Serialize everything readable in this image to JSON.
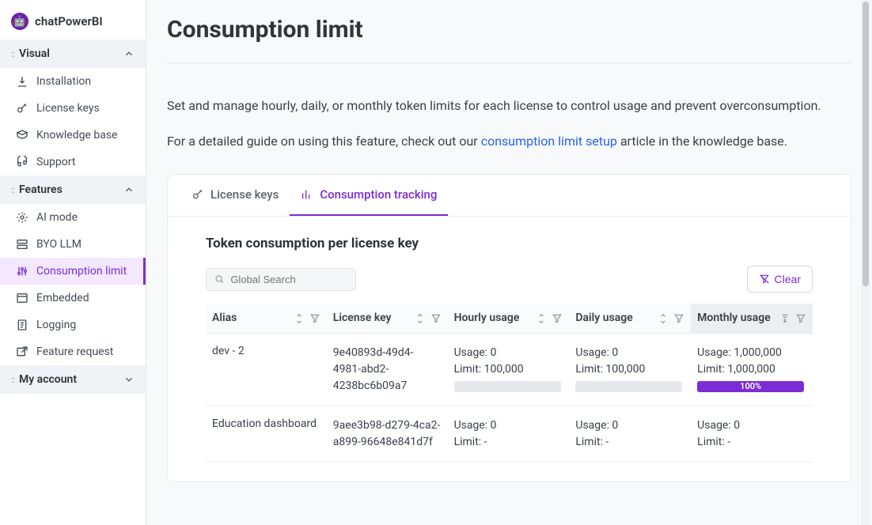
{
  "brand": "chatPowerBI",
  "sidebar": {
    "sections": [
      {
        "title": "Visual",
        "expanded": true,
        "items": [
          {
            "icon": "download",
            "label": "Installation"
          },
          {
            "icon": "key",
            "label": "License keys"
          },
          {
            "icon": "book",
            "label": "Knowledge base"
          },
          {
            "icon": "support",
            "label": "Support"
          }
        ]
      },
      {
        "title": "Features",
        "expanded": true,
        "items": [
          {
            "icon": "gear",
            "label": "AI mode"
          },
          {
            "icon": "server",
            "label": "BYO LLM"
          },
          {
            "icon": "sliders",
            "label": "Consumption limit",
            "active": true
          },
          {
            "icon": "embed",
            "label": "Embedded"
          },
          {
            "icon": "file",
            "label": "Logging"
          },
          {
            "icon": "open",
            "label": "Feature request"
          }
        ]
      },
      {
        "title": "My account",
        "expanded": false,
        "items": []
      }
    ]
  },
  "page": {
    "title": "Consumption limit",
    "desc1": "Set and manage hourly, daily, or monthly token limits for each license to control usage and prevent overconsumption.",
    "desc2_pre": "For a detailed guide on using this feature, check out our ",
    "desc2_link": "consumption limit setup",
    "desc2_post": " article in the knowledge base."
  },
  "tabs": [
    {
      "icon": "key",
      "label": "License keys"
    },
    {
      "icon": "chart",
      "label": "Consumption tracking",
      "active": true
    }
  ],
  "table": {
    "title": "Token consumption per license key",
    "search_placeholder": "Global Search",
    "clear_label": "Clear",
    "columns": [
      {
        "label": "Alias"
      },
      {
        "label": "License key"
      },
      {
        "label": "Hourly usage"
      },
      {
        "label": "Daily usage"
      },
      {
        "label": "Monthly usage",
        "sorted": true
      }
    ],
    "rows": [
      {
        "alias": "dev - 2",
        "key": "9e40893d-49d4-4981-abd2-4238bc6b09a7",
        "hourly": {
          "usage": "Usage: 0",
          "limit": "Limit: 100,000",
          "bar": "empty"
        },
        "daily": {
          "usage": "Usage: 0",
          "limit": "Limit: 100,000",
          "bar": "empty"
        },
        "monthly": {
          "usage": "Usage: 1,000,000",
          "limit": "Limit: 1,000,000",
          "bar": "100%"
        }
      },
      {
        "alias": "Education dashboard",
        "key": "9aee3b98-d279-4ca2-a899-96648e841d7f",
        "hourly": {
          "usage": "Usage: 0",
          "limit": "Limit: -"
        },
        "daily": {
          "usage": "Usage: 0",
          "limit": "Limit: -"
        },
        "monthly": {
          "usage": "Usage: 0",
          "limit": "Limit: -"
        }
      }
    ]
  }
}
